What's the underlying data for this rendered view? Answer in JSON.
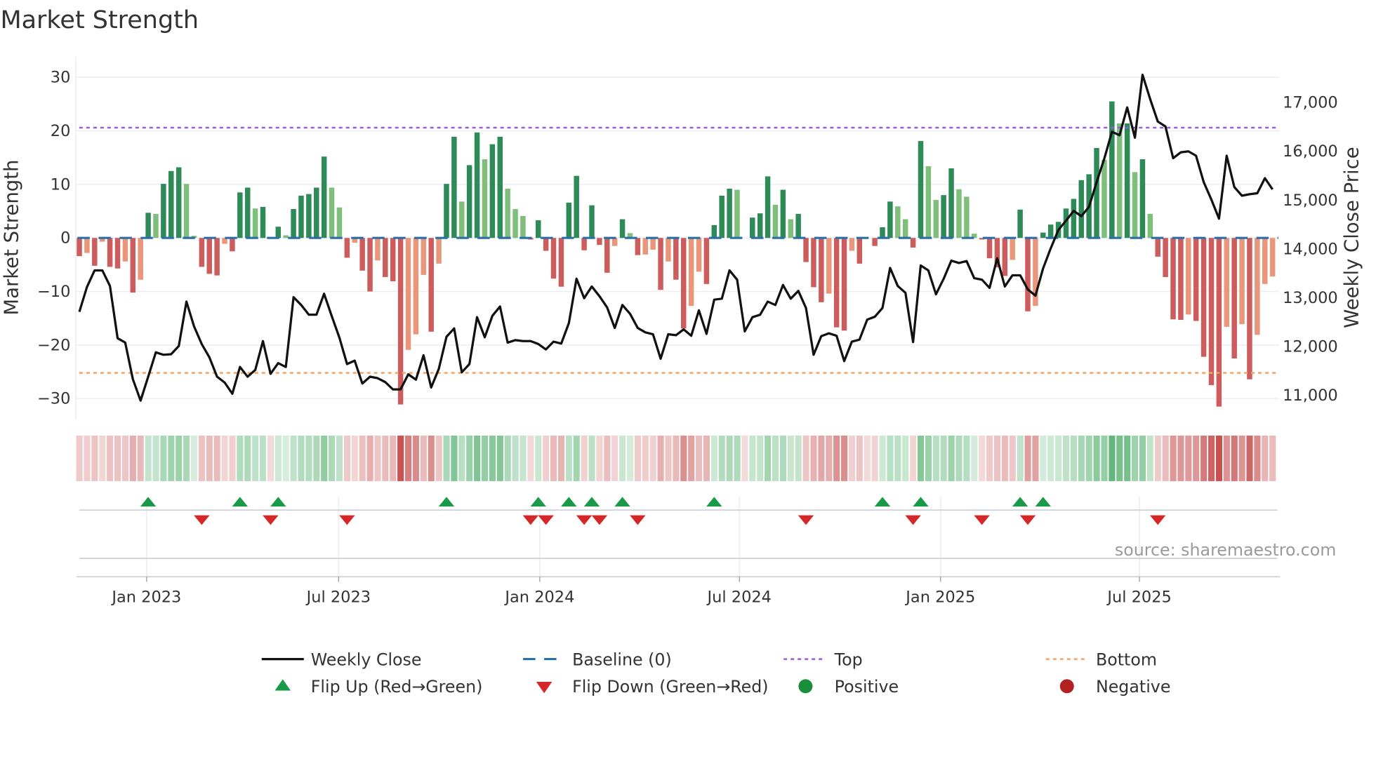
{
  "title": "Market Strength",
  "source": "source: sharemaestro.com",
  "colors": {
    "bar_pos_strong": "#2e8b57",
    "bar_pos_weak": "#7fbf7b",
    "bar_neg_strong": "#cd5c5c",
    "bar_neg_weak": "#e9967a",
    "price": "#111111",
    "baseline": "#2a6fa8",
    "top": "#9b59e0",
    "bottom": "#f4a261",
    "flip_up": "#1a9a48",
    "flip_down": "#d62728",
    "positive": "#1a8f3a",
    "negative": "#b22222"
  },
  "legend": {
    "weekly_close": "Weekly Close",
    "baseline": "Baseline (0)",
    "top": "Top",
    "bottom": "Bottom",
    "flip_up": "Flip Up (Red→Green)",
    "flip_down": "Flip Down (Green→Red)",
    "positive": "Positive",
    "negative": "Negative"
  },
  "chart_data": {
    "type": "bar",
    "title": "Market Strength",
    "ylabel": "Market Strength",
    "ylabel_right": "Weekly Close Price",
    "ylim": [
      -33.8,
      33.8
    ],
    "ylim_right": [
      10515,
      17934
    ],
    "y_ticks": [
      "30",
      "20",
      "10",
      "0",
      "−10",
      "−20",
      "−30"
    ],
    "y_tick_values": [
      30,
      20,
      10,
      0,
      -10,
      -20,
      -30
    ],
    "y_ticks_right": [
      "17,000",
      "16,000",
      "15,000",
      "14,000",
      "13,000",
      "12,000",
      "11,000"
    ],
    "y_tick_values_right": [
      17000,
      16000,
      15000,
      14000,
      13000,
      12000,
      11000
    ],
    "x_ticks": [
      {
        "label": "Jan 2023",
        "week": 9.8
      },
      {
        "label": "Jul 2023",
        "week": 34.9
      },
      {
        "label": "Jan 2024",
        "week": 61.2
      },
      {
        "label": "Jul 2024",
        "week": 87.3
      },
      {
        "label": "Jan 2025",
        "week": 113.6
      },
      {
        "label": "Jul 2025",
        "week": 139.6
      }
    ],
    "top_level": 20.6,
    "bottom_level": -25.2,
    "baseline": 0,
    "grid": true,
    "legend_position": "bottom",
    "series": [
      {
        "name": "Market Strength",
        "type": "bar",
        "values": [
          -3.4,
          -2.8,
          -5.2,
          -0.7,
          -5.4,
          -5.7,
          -4.4,
          -10.2,
          -7.8,
          4.7,
          4.5,
          10.1,
          12.5,
          13.2,
          10.1,
          0.4,
          -5.4,
          -6.7,
          -7.0,
          -1.1,
          -2.5,
          8.5,
          9.4,
          5.5,
          5.8,
          0,
          2.1,
          0.5,
          5.4,
          7.9,
          8.2,
          9.4,
          15.2,
          9.4,
          5.7,
          -3.7,
          -0.9,
          -6.1,
          -10.0,
          -4.2,
          -7.3,
          -8.1,
          -31.1,
          -20.9,
          -18.0,
          -6.9,
          -17.5,
          -4.8,
          10.1,
          18.9,
          6.8,
          13.6,
          19.7,
          14.7,
          17.5,
          18.9,
          9.2,
          5.4,
          4.1,
          -0.3,
          3.3,
          -2.4,
          -7.6,
          -9.1,
          6.6,
          11.6,
          -2.3,
          6.1,
          -1.3,
          -6.5,
          -1.5,
          3.5,
          0.9,
          -3.2,
          -3.1,
          -2.2,
          -9.7,
          -4.4,
          -7.8,
          -16.9,
          -12.7,
          -6.3,
          -8.6,
          2.4,
          7.9,
          9.2,
          9.0,
          0,
          3.8,
          4.6,
          11.5,
          6.2,
          9.0,
          3.5,
          4.5,
          -4.5,
          -9.2,
          -12.0,
          -10.4,
          -16.7,
          -17.3,
          -2.4,
          -4.8,
          0,
          -1.5,
          2.0,
          6.8,
          5.9,
          3.5,
          -1.8,
          18.1,
          13.4,
          7.1,
          8.0,
          13.0,
          9.1,
          7.7,
          0.8,
          -0.3,
          -3.8,
          -5.5,
          -7.1,
          -4.1,
          5.3,
          -13.7,
          -12.7,
          1.0,
          2.5,
          3.0,
          5.5,
          7.3,
          10.8,
          11.9,
          16.8,
          14.6,
          25.5,
          21.4,
          21.4,
          12.3,
          14.7,
          4.5,
          -3.5,
          -7.3,
          -15.2,
          -15.3,
          -14.3,
          -15.5,
          -22.2,
          -27.5,
          -31.5,
          -16.6,
          -22.5,
          -16.1,
          -26.4,
          -18.1,
          -8.6,
          -7.2
        ]
      },
      {
        "name": "Weekly Close",
        "type": "line",
        "axis": "right",
        "values": [
          12710,
          13220,
          13560,
          13560,
          13240,
          12170,
          12080,
          11330,
          10890,
          11380,
          11880,
          11830,
          11840,
          12010,
          12920,
          12410,
          12050,
          11780,
          11380,
          11260,
          11030,
          11580,
          11380,
          11520,
          12110,
          11440,
          11660,
          11580,
          13010,
          12850,
          12650,
          12650,
          13080,
          12620,
          12180,
          11640,
          11710,
          11240,
          11380,
          11350,
          11270,
          11120,
          11120,
          11430,
          11320,
          11820,
          11160,
          11540,
          12200,
          12370,
          11470,
          11640,
          12600,
          12190,
          12630,
          12820,
          12080,
          12130,
          12110,
          12110,
          12050,
          11940,
          12100,
          12060,
          12480,
          13390,
          12990,
          13230,
          13030,
          12800,
          12380,
          12850,
          12670,
          12380,
          12290,
          12250,
          11750,
          12250,
          12230,
          12350,
          12220,
          12740,
          12260,
          12960,
          12980,
          13560,
          13370,
          12310,
          12600,
          12650,
          12920,
          12850,
          13260,
          12980,
          13140,
          12790,
          11830,
          12210,
          12270,
          12220,
          11700,
          12100,
          12140,
          12550,
          12610,
          12790,
          13610,
          13240,
          13100,
          12090,
          13660,
          13560,
          13070,
          13390,
          13760,
          13710,
          13750,
          13400,
          13370,
          13200,
          13810,
          13230,
          13460,
          13460,
          13170,
          13040,
          13600,
          14010,
          14390,
          14580,
          14780,
          14670,
          14860,
          15370,
          15850,
          16400,
          16330,
          16900,
          16280,
          17570,
          17070,
          16610,
          16510,
          15860,
          15980,
          16000,
          15910,
          15370,
          15010,
          14620,
          15910,
          15270,
          15090,
          15120,
          15140,
          15450,
          15220
        ]
      }
    ],
    "flips_up_weeks": [
      10,
      22,
      27,
      49,
      61,
      65,
      68,
      72,
      84,
      106,
      111,
      124,
      127
    ],
    "flips_down_weeks": [
      17,
      26,
      36,
      60,
      62,
      67,
      69,
      74,
      96,
      110,
      119,
      125,
      142
    ]
  }
}
